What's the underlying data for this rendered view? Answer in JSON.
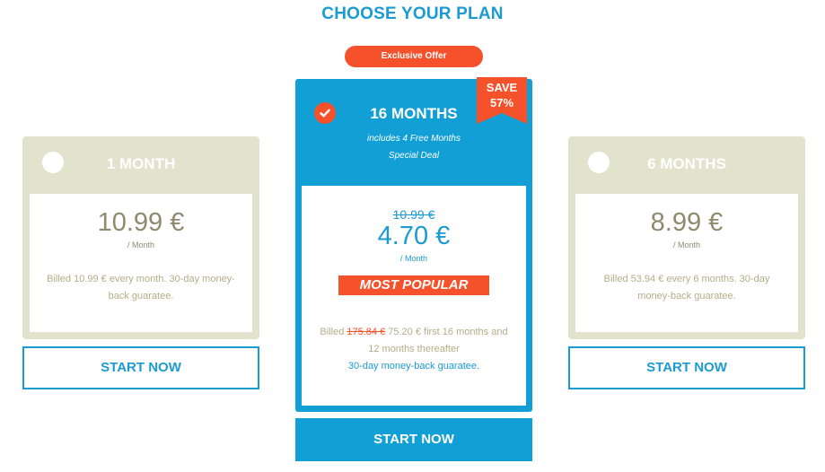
{
  "title": "CHOOSE YOUR PLAN",
  "offer_badge": "Exclusive Offer",
  "colors": {
    "accent_blue": "#1a9bd1",
    "accent_orange": "#f5512b",
    "card_beige": "#e1e3cc",
    "price_olive": "#8f8a6d"
  },
  "plans": {
    "left": {
      "name": "1 MONTH",
      "selected": false,
      "price": "10.99 €",
      "period": "/ Month",
      "billed": "Billed 10.99 € every month. 30-day money-back guaratee.",
      "cta": "START NOW"
    },
    "featured": {
      "name": "16 MONTHS",
      "selected": true,
      "subtitle_1": "includes 4 Free Months",
      "subtitle_2": "Special Deal",
      "save_line1": "SAVE",
      "save_line2": "57%",
      "old_price": "10.99 €",
      "price": "4.70 €",
      "period": "/ Month",
      "popular": "MOST POPULAR",
      "billed_prefix": "Billed",
      "billed_old": "175.84 €",
      "billed_new": "75.20 € first 16 months and",
      "billed_line2": "12 months thereafter",
      "guarantee": "30-day money-back guaratee.",
      "cta": "START NOW"
    },
    "right": {
      "name": "6 MONTHS",
      "selected": false,
      "price": "8.99 €",
      "period": "/ Month",
      "billed": "Billed 53.94 € every 6 months. 30-day money-back guaratee.",
      "cta": "START NOW"
    }
  }
}
